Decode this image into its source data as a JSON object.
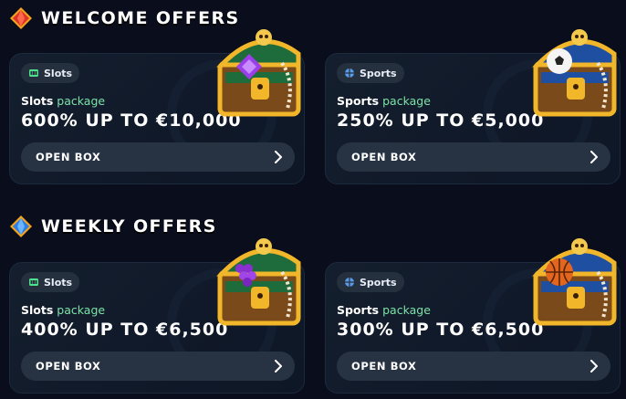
{
  "sections": [
    {
      "title": "WELCOME OFFERS",
      "icon": "red-gem-icon",
      "cards": [
        {
          "tag": "Slots",
          "tag_icon": "slot-machine-icon",
          "package_name": "Slots",
          "package_word": "package",
          "amount": "600% UP TO €10,000",
          "button": "OPEN BOX",
          "chest": "chest-with-purple-gem"
        },
        {
          "tag": "Sports",
          "tag_icon": "sports-ball-icon",
          "package_name": "Sports",
          "package_word": "package",
          "amount": "250% UP TO €5,000",
          "button": "OPEN BOX",
          "chest": "chest-with-soccer-ball"
        }
      ]
    },
    {
      "title": "WEEKLY OFFERS",
      "icon": "blue-gem-icon",
      "cards": [
        {
          "tag": "Slots",
          "tag_icon": "slot-machine-icon",
          "package_name": "Slots",
          "package_word": "package",
          "amount": "400% UP TO €6,500",
          "button": "OPEN BOX",
          "chest": "chest-with-grapes"
        },
        {
          "tag": "Sports",
          "tag_icon": "sports-ball-icon",
          "package_name": "Sports",
          "package_word": "package",
          "amount": "300% UP TO €6,500",
          "button": "OPEN BOX",
          "chest": "chest-with-basketball"
        }
      ]
    }
  ],
  "colors": {
    "background": "#0a0d1c",
    "card": "#121c2b",
    "button": "#273243",
    "accent": "#7ee3a7",
    "red_gem": "#e0322b",
    "blue_gem": "#2f7de6"
  }
}
